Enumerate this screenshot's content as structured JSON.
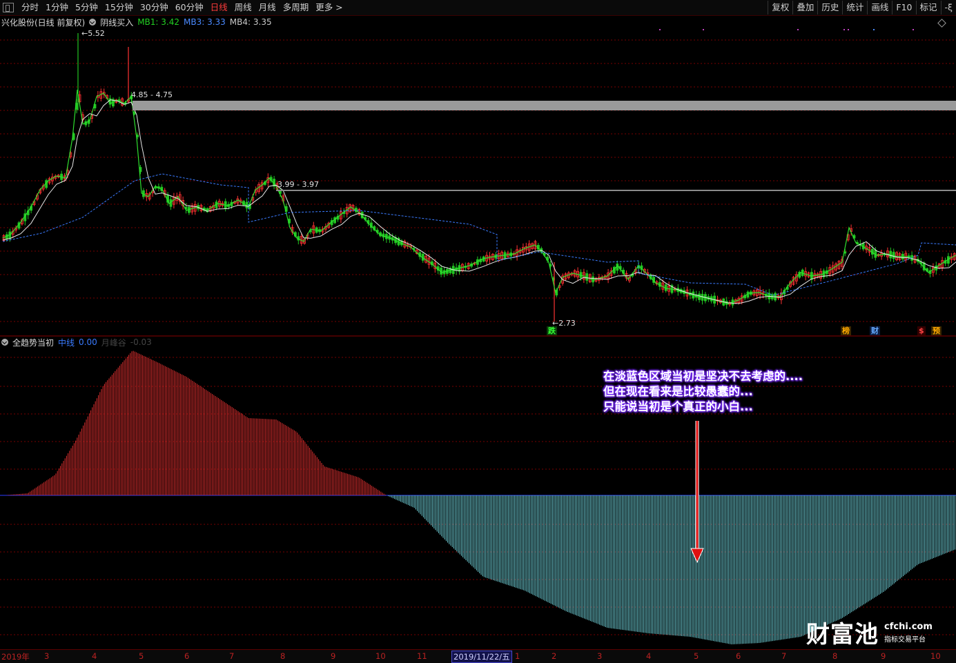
{
  "toolbar": {
    "periods": [
      "分时",
      "1分钟",
      "5分钟",
      "15分钟",
      "30分钟",
      "60分钟",
      "日线",
      "周线",
      "月线",
      "多周期",
      "更多 >"
    ],
    "active_period": "日线",
    "right_buttons": [
      "复权",
      "叠加",
      "历史",
      "统计",
      "画线",
      "F10",
      "标记",
      "-ξ"
    ]
  },
  "main_chart": {
    "stock": "兴化股份(日线 前复权)",
    "indicator": "阴线买入",
    "mb1": "MB1: 3.42",
    "mb3": "MB3: 3.33",
    "mb4": "MB4: 3.35",
    "high_label": "5.52",
    "low_label": "2.73",
    "zone1_label": "4.85 - 4.75",
    "zone2_label": "3.99 - 3.97",
    "event_markers": [
      "跌",
      "榜",
      "财",
      "$",
      "预"
    ]
  },
  "sub_chart": {
    "indicator": "全趋势当初",
    "zhongxian": "中线",
    "zhongxian_val": "0.00",
    "yuexian": "月峰谷",
    "yuexian_val": "-0.03"
  },
  "annotation": {
    "lines": [
      "在淡蓝色区域当初是坚决不去考虑的....",
      "但在现在看来是比较愚蠢的...",
      "只能说当初是个真正的小白..."
    ]
  },
  "x_axis": {
    "ticks": [
      "2019年",
      "3",
      "4",
      "5",
      "6",
      "7",
      "8",
      "9",
      "10",
      "11",
      "1",
      "2",
      "3",
      "4",
      "5",
      "6",
      "7",
      "8",
      "9",
      "10"
    ],
    "cursor_label": "2019/11/22/五"
  },
  "watermark": {
    "logo": "财富池",
    "domain": "cfchi.com",
    "tagline": "指标交易平台"
  },
  "colors": {
    "up": "#ff3232",
    "down": "#22c522",
    "ma_white": "#e8e8e8",
    "ma_blue": "#3a7bff",
    "hist_pos": "#e03030",
    "hist_neg": "#6fd0d8",
    "grid": "#7a0000"
  }
}
